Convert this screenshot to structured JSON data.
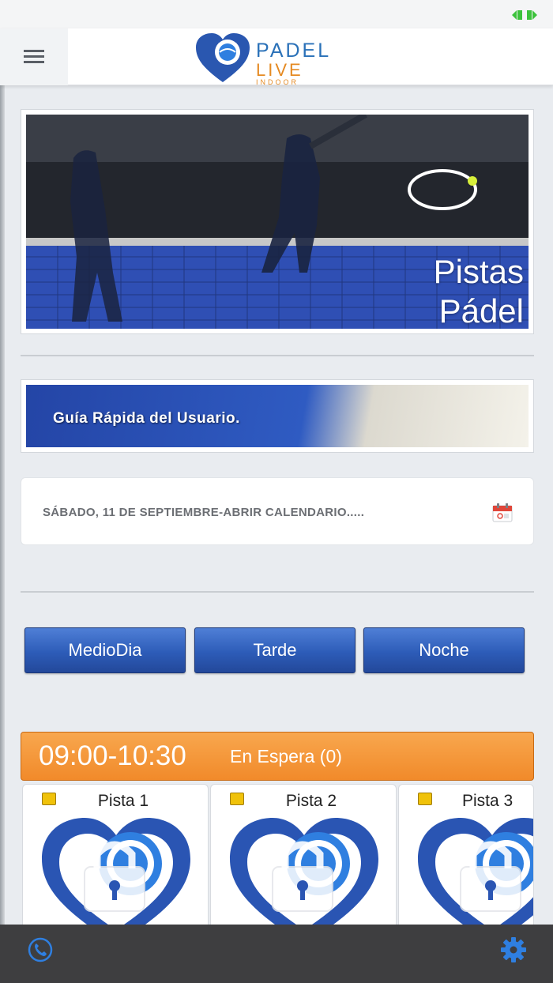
{
  "header": {
    "brand_line1": "PADEL",
    "brand_line2": "LIVE",
    "brand_line3": "INDOOR"
  },
  "hero_banner": {
    "title_line1": "Pistas",
    "title_line2": "Pádel"
  },
  "quick_guide_banner": {
    "title": "Guía Rápida del Usuario."
  },
  "date_selector": {
    "label": "SÁBADO, 11 DE SEPTIEMBRE-ABRIR CALENDARIO....."
  },
  "time_filters": [
    {
      "label": "MedioDia"
    },
    {
      "label": "Tarde"
    },
    {
      "label": "Noche"
    }
  ],
  "slot": {
    "time": "09:00-10:30",
    "status": "En Espera (0)"
  },
  "courts": [
    {
      "name": "Pista 1"
    },
    {
      "name": "Pista 2"
    },
    {
      "name": "Pista 3"
    }
  ],
  "colors": {
    "primary_blue": "#2d5cb8",
    "slot_orange": "#f18a2a",
    "bottom_bar": "#3e3e40",
    "icon_blue": "#2f7fe0"
  },
  "icons": [
    "expand-icon",
    "menu-icon",
    "calendar-icon",
    "lock-icon",
    "phone-icon",
    "gear-icon"
  ]
}
